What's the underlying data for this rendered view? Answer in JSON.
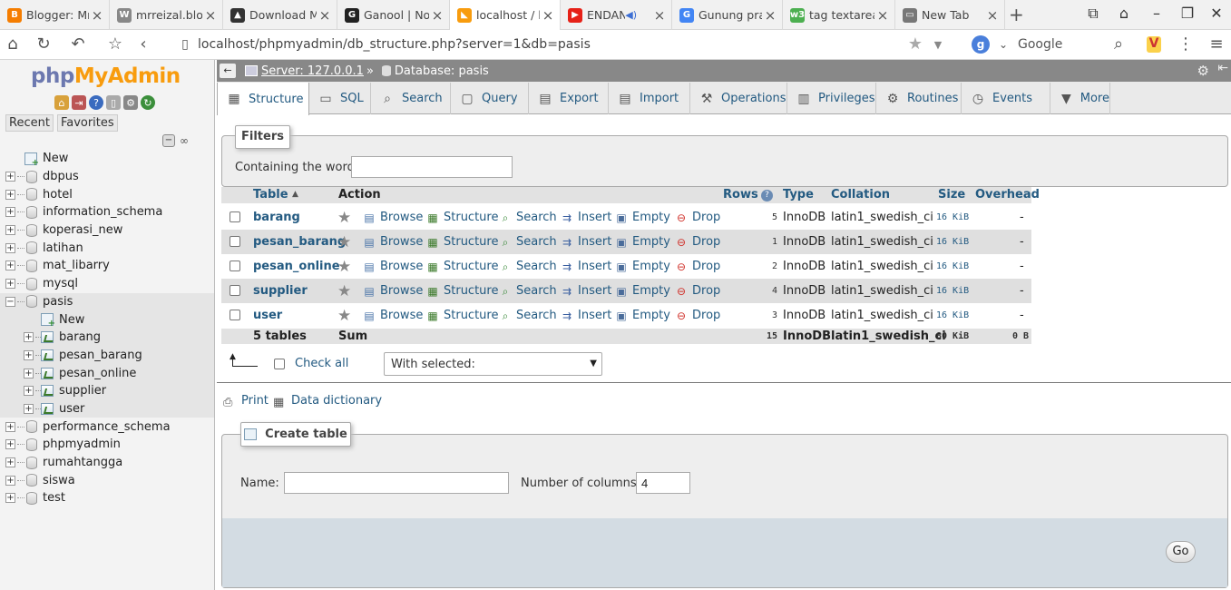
{
  "browser": {
    "tabs": [
      {
        "title": "Blogger: Mr",
        "favicon": "blogger",
        "color": "#f57d00",
        "active": false
      },
      {
        "title": "mrreizal.blo",
        "favicon": "wordpress",
        "color": "#888888",
        "active": false
      },
      {
        "title": "Download M",
        "favicon": "linux",
        "color": "#333333",
        "active": false
      },
      {
        "title": "Ganool | No",
        "favicon": "ganool",
        "color": "#222222",
        "active": false
      },
      {
        "title": "localhost / l",
        "favicon": "pma",
        "color": "#f89c0e",
        "active": true
      },
      {
        "title": "ENDANK",
        "favicon": "youtube",
        "color": "#e62117",
        "active": false
      },
      {
        "title": "Gunung pra",
        "favicon": "google",
        "color": "#4285f4",
        "active": false
      },
      {
        "title": "tag textarea",
        "favicon": "w3",
        "color": "#4caf50",
        "active": false
      },
      {
        "title": "New Tab",
        "favicon": "page",
        "color": "#777777",
        "active": false
      }
    ],
    "url": "localhost/phpmyadmin/db_structure.php?server=1&db=pasis",
    "search_engine": "Google"
  },
  "logo": {
    "php": "php",
    "myadmin": "MyAdmin"
  },
  "left": {
    "recent_label": "Recent",
    "favorites_label": "Favorites",
    "new_label": "New",
    "databases": [
      "dbpus",
      "hotel",
      "information_schema",
      "koperasi_new",
      "latihan",
      "mat_libarry",
      "mysql",
      "pasis"
    ],
    "selected_new_label": "New",
    "selected_tables": [
      "barang",
      "pesan_barang",
      "pesan_online",
      "supplier",
      "user"
    ],
    "databases_after": [
      "performance_schema",
      "phpmyadmin",
      "rumahtangga",
      "siswa",
      "test"
    ]
  },
  "breadcrumb": {
    "server": "Server: 127.0.0.1",
    "sep": "»",
    "database": "Database: pasis"
  },
  "menu": [
    {
      "label": "Structure",
      "icon": "structure-icon"
    },
    {
      "label": "SQL",
      "icon": "sql-icon"
    },
    {
      "label": "Search",
      "icon": "search-icon"
    },
    {
      "label": "Query",
      "icon": "query-icon"
    },
    {
      "label": "Export",
      "icon": "export-icon"
    },
    {
      "label": "Import",
      "icon": "import-icon"
    },
    {
      "label": "Operations",
      "icon": "operations-icon"
    },
    {
      "label": "Privileges",
      "icon": "privileges-icon"
    },
    {
      "label": "Routines",
      "icon": "routines-icon"
    },
    {
      "label": "Events",
      "icon": "events-icon"
    },
    {
      "label": "More",
      "icon": "more-icon"
    }
  ],
  "filters": {
    "legend": "Filters",
    "label": "Containing the word:",
    "value": ""
  },
  "table": {
    "headers": {
      "table": "Table",
      "action": "Action",
      "rows": "Rows",
      "type": "Type",
      "collation": "Collation",
      "size": "Size",
      "overhead": "Overhead"
    },
    "actions": {
      "browse": "Browse",
      "structure": "Structure",
      "search": "Search",
      "insert": "Insert",
      "empty": "Empty",
      "drop": "Drop"
    },
    "rows": [
      {
        "name": "barang",
        "rows": "5",
        "type": "InnoDB",
        "collation": "latin1_swedish_ci",
        "size": "16 KiB",
        "overhead": "-"
      },
      {
        "name": "pesan_barang",
        "rows": "1",
        "type": "InnoDB",
        "collation": "latin1_swedish_ci",
        "size": "16 KiB",
        "overhead": "-"
      },
      {
        "name": "pesan_online",
        "rows": "2",
        "type": "InnoDB",
        "collation": "latin1_swedish_ci",
        "size": "16 KiB",
        "overhead": "-"
      },
      {
        "name": "supplier",
        "rows": "4",
        "type": "InnoDB",
        "collation": "latin1_swedish_ci",
        "size": "16 KiB",
        "overhead": "-"
      },
      {
        "name": "user",
        "rows": "3",
        "type": "InnoDB",
        "collation": "latin1_swedish_ci",
        "size": "16 KiB",
        "overhead": "-"
      }
    ],
    "summary": {
      "tables": "5 tables",
      "sum": "Sum",
      "rows": "15",
      "type": "InnoDB",
      "collation": "latin1_swedish_ci",
      "size": "80 KiB",
      "overhead": "0 B"
    }
  },
  "bulk": {
    "check_all": "Check all",
    "with_selected": "With selected:"
  },
  "links": {
    "print": "Print",
    "data_dictionary": "Data dictionary"
  },
  "create": {
    "legend": "Create table",
    "name_label": "Name:",
    "name_value": "",
    "columns_label": "Number of columns:",
    "columns_value": "4",
    "go": "Go"
  }
}
